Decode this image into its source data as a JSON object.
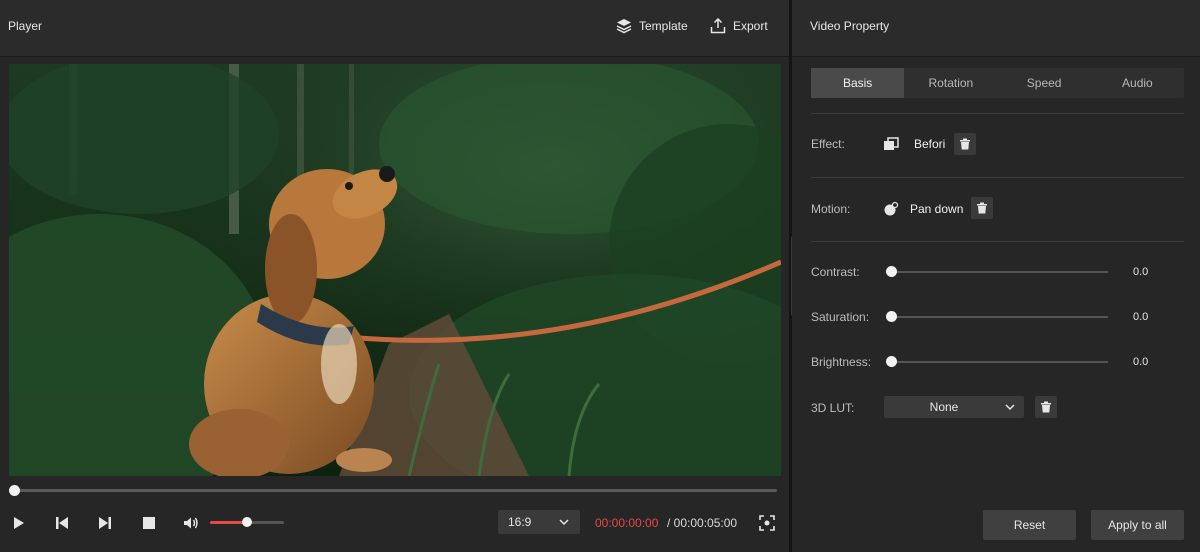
{
  "player": {
    "title": "Player",
    "template_label": "Template",
    "export_label": "Export",
    "playhead_fraction": 0.0,
    "volume_fraction": 0.5,
    "aspect_ratio": "16:9",
    "time_current": "00:00:00:00",
    "time_total": "/ 00:00:05:00",
    "accent_color": "#e64a46"
  },
  "video": {
    "description_icon": "video-frame"
  },
  "properties": {
    "title": "Video Property",
    "tabs": [
      {
        "label": "Basis",
        "active": true
      },
      {
        "label": "Rotation",
        "active": false
      },
      {
        "label": "Speed",
        "active": false
      },
      {
        "label": "Audio",
        "active": false
      }
    ],
    "effect": {
      "label": "Effect:",
      "value": "Befori"
    },
    "motion": {
      "label": "Motion:",
      "value": "Pan down"
    },
    "contrast": {
      "label": "Contrast:",
      "value": "0.0"
    },
    "saturation": {
      "label": "Saturation:",
      "value": "0.0"
    },
    "brightness": {
      "label": "Brightness:",
      "value": "0.0"
    },
    "lut": {
      "label": "3D LUT:",
      "value": "None"
    },
    "reset_label": "Reset",
    "apply_label": "Apply to all"
  }
}
